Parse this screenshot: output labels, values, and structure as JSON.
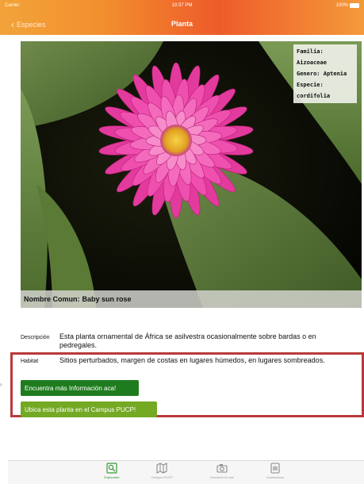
{
  "status_bar": {
    "carrier": "Carrier",
    "time": "10:37 PM",
    "battery": "100%"
  },
  "nav": {
    "back_label": "Especies",
    "title": "Planta"
  },
  "plant": {
    "taxonomy": [
      {
        "label": "Familia",
        "value": "Aizoaceae"
      },
      {
        "label": "Genero",
        "value": "Aptenia"
      },
      {
        "label": "Especie",
        "value": "cordifolia"
      }
    ],
    "common_name_label": "Nombre Comun:",
    "common_name": "Baby sun rose",
    "description_label": "Descripción",
    "description": "Esta planta ornamental de África se asilvestra ocasionalmente sobre bardas o en pedregales.",
    "habitat_label": "Habitat",
    "habitat": "Sitios perturbados, margen de costas en lugares húmedos, en lugares sombreados."
  },
  "actions": {
    "more_info_label": "Encuentra más Información aca!",
    "locate_label": "Ubica esta planta en el Campus PUCP!"
  },
  "tabs": [
    {
      "label": "Explorador",
      "icon": "explorer-icon",
      "active": true
    },
    {
      "label": "Campus PUCP",
      "icon": "map-icon",
      "active": false
    },
    {
      "label": "Descubre tú mas",
      "icon": "camera-icon",
      "active": false
    },
    {
      "label": "Contáctanos",
      "icon": "contact-icon",
      "active": false
    }
  ],
  "colors": {
    "nav_orange": "#f28f2e",
    "nav_red": "#ee5b2a",
    "btn_dark_green": "#1e7c1e",
    "btn_light_green": "#74a923",
    "highlight_red": "#b83a3a",
    "active_tab": "#2f8f2f"
  }
}
